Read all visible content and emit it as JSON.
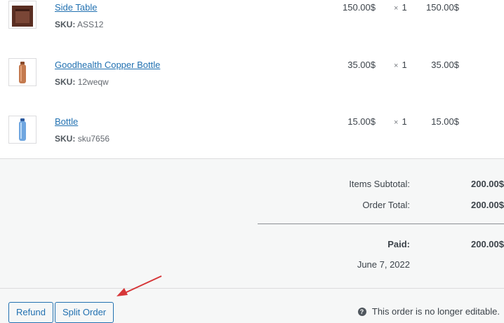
{
  "items": [
    {
      "name": "Side Table",
      "sku_label": "SKU:",
      "sku": "ASS12",
      "cost": "150.00$",
      "qty_symbol": "×",
      "qty": "1",
      "total": "150.00$",
      "thumb": "side-table"
    },
    {
      "name": "Goodhealth Copper Bottle",
      "sku_label": "SKU:",
      "sku": "12weqw",
      "cost": "35.00$",
      "qty_symbol": "×",
      "qty": "1",
      "total": "35.00$",
      "thumb": "copper-bottle"
    },
    {
      "name": "Bottle",
      "sku_label": "SKU:",
      "sku": "sku7656",
      "cost": "15.00$",
      "qty_symbol": "×",
      "qty": "1",
      "total": "15.00$",
      "thumb": "blue-bottle"
    }
  ],
  "totals": {
    "subtotal_label": "Items Subtotal:",
    "subtotal_value": "200.00$",
    "order_total_label": "Order Total:",
    "order_total_value": "200.00$",
    "paid_label": "Paid:",
    "paid_value": "200.00$",
    "paid_date": "June 7, 2022"
  },
  "actions": {
    "refund_label": "Refund",
    "split_label": "Split Order",
    "note_icon": "?",
    "note": "This order is no longer editable."
  },
  "colors": {
    "link": "#2271b1",
    "arrow": "#d63638"
  }
}
